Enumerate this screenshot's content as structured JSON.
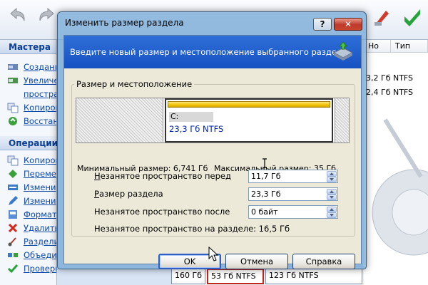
{
  "window": {
    "title": "Изменить размер раздела",
    "help_button": "?",
    "close_button": "✕"
  },
  "header": {
    "instruction": "Введите новый размер и местоположение выбранного раздела."
  },
  "group": {
    "legend": "Размер и местоположение"
  },
  "partition_map": {
    "drive_letter": "C:",
    "size_fs": "23,3 Гб  NTFS"
  },
  "limits": {
    "min_label": "Минимальный размер: 6,741 Гб",
    "max_label": "Максимальный размер: 35 Гб"
  },
  "fields": [
    {
      "label": "Незанятое пространство перед",
      "value": "11,7 Гб"
    },
    {
      "label": "Размер раздела",
      "value": "23,3 Гб"
    },
    {
      "label": "Незанятое пространство после",
      "value": "0 байт"
    }
  ],
  "free_on_partition": "Незанятое пространство на разделе: 16,5 Гб",
  "buttons": {
    "ok": "OK",
    "cancel": "Отмена",
    "help": "Справка"
  },
  "sidebar": {
    "section1_title": "Мастера",
    "section1_items": [
      "Создани",
      "Увеличе",
      "простра",
      "Копиров",
      "Восстан"
    ],
    "section2_title": "Операции",
    "section2_items": [
      "Копиров",
      "Переме",
      "Измени",
      "Измени",
      "Формат",
      "Удалить",
      "Раздели",
      "Объеди",
      "Проверить"
    ]
  },
  "list": {
    "col1": "Но",
    "col2": "Тип",
    "rows": [
      "3,2 Гб  NTFS",
      "2,4 Гб  NTFS"
    ]
  },
  "bottom": {
    "cell1": "160 Гб",
    "cell2": "53 Гб  NTFS",
    "cell3": "123 Гб  NTFS"
  },
  "colors": {
    "header_blue": "#1a56c4",
    "bar_yellow": "#f2c200",
    "size_text": "#00249c",
    "sidebar_link": "#0c4aa8"
  },
  "icons": [
    "undo-icon",
    "redo-icon",
    "wizard-icon",
    "apply-icon",
    "disk-icon",
    "cursor-icon"
  ]
}
